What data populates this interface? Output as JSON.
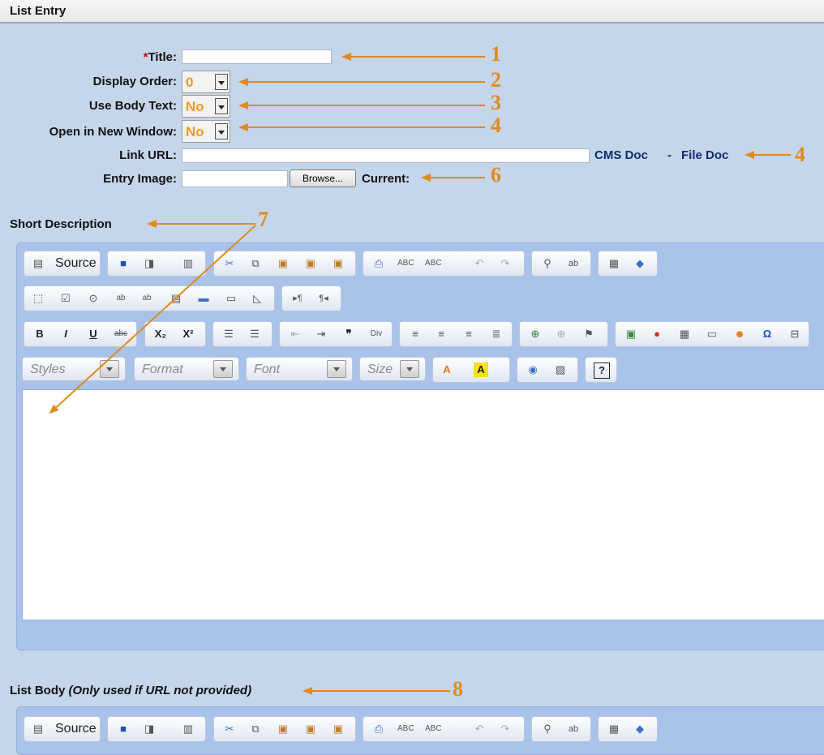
{
  "header": {
    "title": "List Entry"
  },
  "form": {
    "title_required": "*",
    "title_label": "Title:",
    "display_order_label": "Display Order:",
    "display_order_value": "0",
    "use_body_text_label": "Use Body Text:",
    "use_body_text_value": "No",
    "open_new_window_label": "Open in New Window:",
    "open_new_window_value": "No",
    "link_url_label": "Link URL:",
    "cms_doc": "CMS Doc",
    "separator": "-",
    "file_doc": "File Doc",
    "entry_image_label": "Entry Image:",
    "browse_label": "Browse...",
    "current_label": "Current:"
  },
  "annotations": {
    "n1": "1",
    "n2": "2",
    "n3": "3",
    "n4a": "4",
    "n4b": "4",
    "n6": "6",
    "n7": "7",
    "n8": "8",
    "color": "#e08a1e"
  },
  "short_description": {
    "label": "Short Description",
    "source_label": "Source",
    "styles": "Styles",
    "format": "Format",
    "font": "Font",
    "size": "Size"
  },
  "list_body": {
    "label": "List Body ",
    "note": "(Only used if URL not provided)",
    "source_label": "Source"
  },
  "colors": {
    "background": "#c5d5ea",
    "editor": "#a9c2ea",
    "link": "#0f2d6e",
    "accent": "#f39a1f"
  }
}
